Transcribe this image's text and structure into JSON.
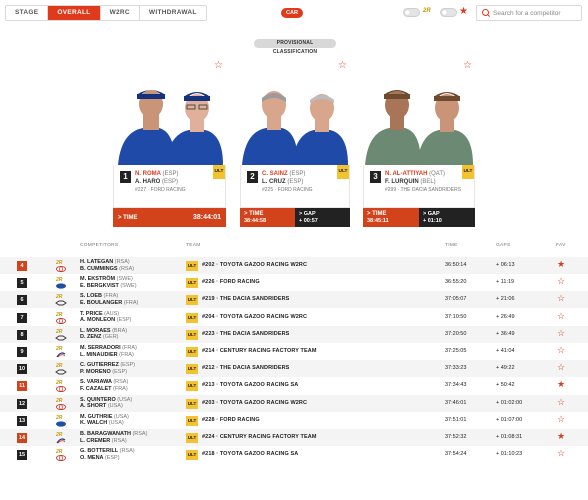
{
  "tabs": [
    "STAGE",
    "OVERALL",
    "W2RC",
    "WITHDRAWAL"
  ],
  "active_tab": "OVERALL",
  "category_pill": "CAR",
  "toggles": {
    "ultimate_logo": "2R",
    "favorites_icon": "star-icon"
  },
  "search": {
    "placeholder": "Search for a competitor"
  },
  "banner": "PROVISIONAL CLASSIFICATION",
  "colors": {
    "accent": "#e03a1c",
    "dark": "#222222",
    "ult": "#f2c230"
  },
  "podium": [
    {
      "position": "1",
      "driver": "N. ROMA",
      "driver_nat": "(ESP)",
      "codriver": "A. HARO",
      "codriver_nat": "(ESP)",
      "team": "#227 · FORD RACING",
      "badge": "ULT",
      "time_label": "> TIME",
      "time": "38:44:01",
      "gap_label": "",
      "gap": ""
    },
    {
      "position": "2",
      "driver": "C. SAINZ",
      "driver_nat": "(ESP)",
      "codriver": "L. CRUZ",
      "codriver_nat": "(ESP)",
      "team": "#225 · FORD RACING",
      "badge": "ULT",
      "time_label": "> TIME",
      "time": "38:44:58",
      "gap_label": "> GAP",
      "gap": "+ 00:57"
    },
    {
      "position": "3",
      "driver": "N. AL-ATTIYAH",
      "driver_nat": "(QAT)",
      "codriver": "F. LURQUIN",
      "codriver_nat": "(BEL)",
      "team": "#299 · THE DACIA SANDRIDERS",
      "badge": "ULT",
      "time_label": "> TIME",
      "time": "38:45:11",
      "gap_label": "> GAP",
      "gap": "+ 01:10"
    }
  ],
  "table": {
    "headers": {
      "competitors": "COMPETITORS",
      "team": "TEAM",
      "time": "TIME",
      "gaps": "GAPS",
      "fav": "FAV"
    },
    "rows": [
      {
        "rank": "4",
        "driver": "H. LATEGAN",
        "dnat": "(RSA)",
        "codriver": "B. CUMMINGS",
        "cnat": "(RSA)",
        "badge": "ULT",
        "team": "#202 · TOYOTA GAZOO RACING W2RC",
        "time": "36:50:14",
        "gap": "+ 06:13",
        "brand": "toyota",
        "fav": true
      },
      {
        "rank": "5",
        "driver": "M. EKSTRÖM",
        "dnat": "(SWE)",
        "codriver": "E. BERGKVIST",
        "cnat": "(SWE)",
        "badge": "ULT",
        "team": "#226 · FORD RACING",
        "time": "36:55:20",
        "gap": "+ 11:19",
        "brand": "ford",
        "fav": false
      },
      {
        "rank": "6",
        "driver": "S. LOEB",
        "dnat": "(FRA)",
        "codriver": "E. BOULANGER",
        "cnat": "(FRA)",
        "badge": "ULT",
        "team": "#219 · THE DACIA SANDRIDERS",
        "time": "37:05:07",
        "gap": "+ 21:06",
        "brand": "dacia",
        "fav": false
      },
      {
        "rank": "7",
        "driver": "T. PRICE",
        "dnat": "(AUS)",
        "codriver": "A. MONLEON",
        "cnat": "(ESP)",
        "badge": "ULT",
        "team": "#204 · TOYOTA GAZOO RACING W2RC",
        "time": "37:10:50",
        "gap": "+ 26:49",
        "brand": "toyota",
        "fav": false
      },
      {
        "rank": "8",
        "driver": "L. MORAES",
        "dnat": "(BRA)",
        "codriver": "D. ZENZ",
        "cnat": "(GER)",
        "badge": "ULT",
        "team": "#223 · THE DACIA SANDRIDERS",
        "time": "37:20:50",
        "gap": "+ 36:49",
        "brand": "dacia",
        "fav": false
      },
      {
        "rank": "9",
        "driver": "M. SERRADORI",
        "dnat": "(FRA)",
        "codriver": "L. MINAUDIER",
        "cnat": "(FRA)",
        "badge": "ULT",
        "team": "#214 · CENTURY RACING FACTORY TEAM",
        "time": "37:25:05",
        "gap": "+ 41:04",
        "brand": "century",
        "fav": false
      },
      {
        "rank": "10",
        "driver": "C. GUTIERREZ",
        "dnat": "(ESP)",
        "codriver": "P. MORENO",
        "cnat": "(ESP)",
        "badge": "ULT",
        "team": "#212 · THE DACIA SANDRIDERS",
        "time": "37:33:23",
        "gap": "+ 49:22",
        "brand": "dacia",
        "fav": false
      },
      {
        "rank": "11",
        "driver": "S. VARIAWA",
        "dnat": "(RSA)",
        "codriver": "F. CAZALET",
        "cnat": "(FRA)",
        "badge": "ULT",
        "team": "#213 · TOYOTA GAZOO RACING SA",
        "time": "37:34:43",
        "gap": "+ 50:42",
        "brand": "toyota",
        "fav": true
      },
      {
        "rank": "12",
        "driver": "S. QUINTERO",
        "dnat": "(USA)",
        "codriver": "A. SHORT",
        "cnat": "(USA)",
        "badge": "ULT",
        "team": "#203 · TOYOTA GAZOO RACING W2RC",
        "time": "37:46:01",
        "gap": "+ 01:02:00",
        "brand": "toyota",
        "fav": false
      },
      {
        "rank": "13",
        "driver": "M. GUTHRIE",
        "dnat": "(USA)",
        "codriver": "K. WALCH",
        "cnat": "(USA)",
        "badge": "ULT",
        "team": "#228 · FORD RACING",
        "time": "37:51:01",
        "gap": "+ 01:07:00",
        "brand": "ford",
        "fav": false
      },
      {
        "rank": "14",
        "driver": "B. BARAGWANATH",
        "dnat": "(RSA)",
        "codriver": "L. CREMER",
        "cnat": "(RSA)",
        "badge": "ULT",
        "team": "#224 · CENTURY RACING FACTORY TEAM",
        "time": "37:52:32",
        "gap": "+ 01:08:31",
        "brand": "century",
        "fav": true
      },
      {
        "rank": "15",
        "driver": "G. BOTTERILL",
        "dnat": "(RSA)",
        "codriver": "O. MENA",
        "cnat": "(ESP)",
        "badge": "ULT",
        "team": "#218 · TOYOTA GAZOO RACING SA",
        "time": "37:54:24",
        "gap": "+ 01:10:23",
        "brand": "toyota",
        "fav": false
      }
    ]
  }
}
